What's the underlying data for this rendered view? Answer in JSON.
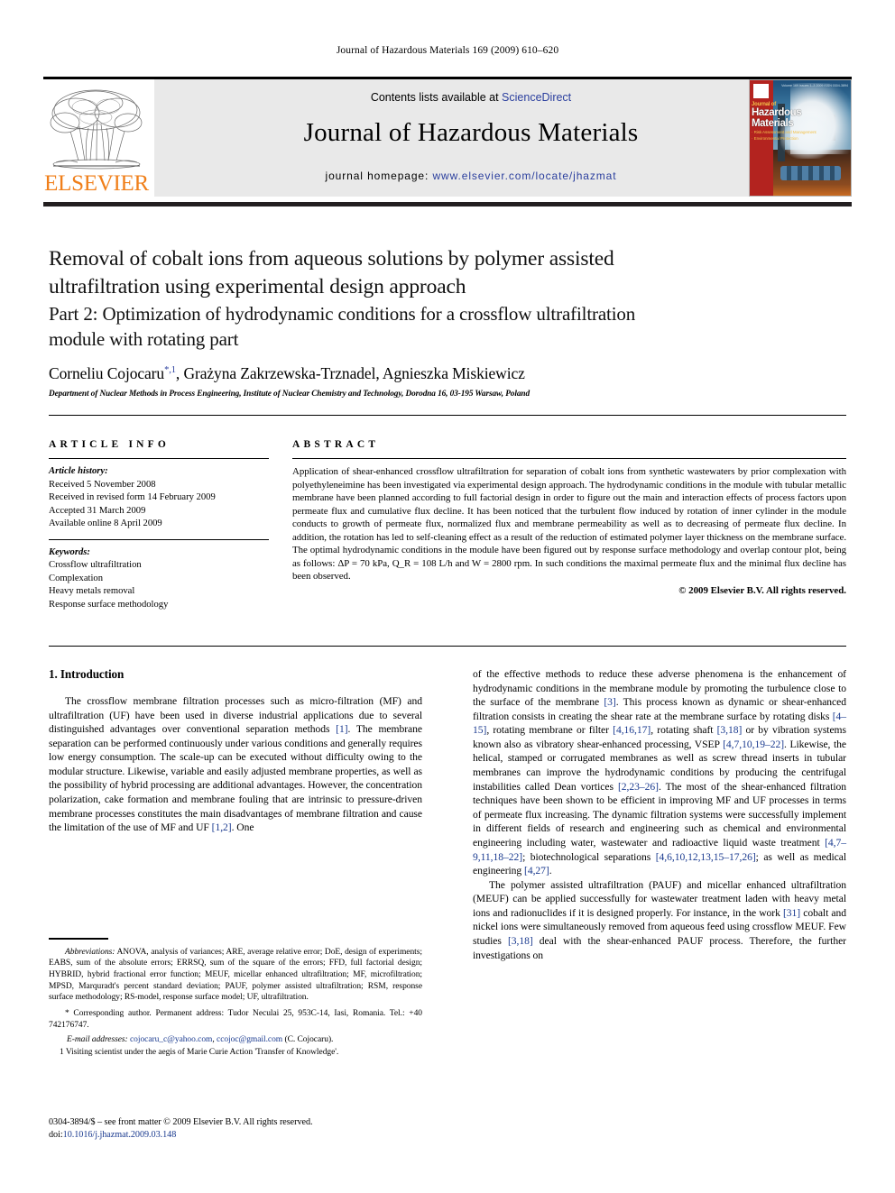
{
  "running_head": "Journal of Hazardous Materials 169 (2009) 610–620",
  "masthead": {
    "publisher_name": "ELSEVIER",
    "contents_prefix": "Contents lists available at ",
    "contents_link": "ScienceDirect",
    "journal_title": "Journal of Hazardous Materials",
    "homepage_label": "journal homepage: ",
    "homepage_url": "www.elsevier.com/locate/jhazmat",
    "cover": {
      "kicker": "Journal of",
      "line1": "Hazardous",
      "line2": "Materials",
      "sub1": "· Risk Assessment and Management",
      "sub2": "· Environmental Protection",
      "corner_note": "Volume 169 Issues 1–3  2009\nISSN 0304-3894"
    },
    "link_color": "#2b3f9e"
  },
  "title_block": {
    "title_line1": "Removal of cobalt ions from aqueous solutions by polymer assisted",
    "title_line2": "ultrafiltration using experimental design approach",
    "subtitle_line1": "Part 2: Optimization of hydrodynamic conditions for a crossflow ultrafiltration",
    "subtitle_line2": "module with rotating part",
    "author1": "Corneliu Cojocaru",
    "author1_marks": "*,1",
    "authors_rest": ", Grażyna Zakrzewska-Trznadel, Agnieszka Miskiewicz",
    "affiliation": "Department of Nuclear Methods in Process Engineering, Institute of Nuclear Chemistry and Technology, Dorodna 16, 03-195 Warsaw, Poland"
  },
  "article_info": {
    "heading": "ARTICLE INFO",
    "history_label": "Article history:",
    "history": [
      "Received 5 November 2008",
      "Received in revised form 14 February 2009",
      "Accepted 31 March 2009",
      "Available online 8 April 2009"
    ],
    "keywords_label": "Keywords:",
    "keywords": [
      "Crossflow ultrafiltration",
      "Complexation",
      "Heavy metals removal",
      "Response surface methodology"
    ]
  },
  "abstract": {
    "heading": "ABSTRACT",
    "text": "Application of shear-enhanced crossflow ultrafiltration for separation of cobalt ions from synthetic wastewaters by prior complexation with polyethyleneimine has been investigated via experimental design approach. The hydrodynamic conditions in the module with tubular metallic membrane have been planned according to full factorial design in order to figure out the main and interaction effects of process factors upon permeate flux and cumulative flux decline. It has been noticed that the turbulent flow induced by rotation of inner cylinder in the module conducts to growth of permeate flux, normalized flux and membrane permeability as well as to decreasing of permeate flux decline. In addition, the rotation has led to self-cleaning effect as a result of the reduction of estimated polymer layer thickness on the membrane surface. The optimal hydrodynamic conditions in the module have been figured out by response surface methodology and overlap contour plot, being as follows: ΔP = 70 kPa, Q_R = 108 L/h and W = 2800 rpm. In such conditions the maximal permeate flux and the minimal flux decline has been observed.",
    "copyright": "© 2009 Elsevier B.V. All rights reserved."
  },
  "body": {
    "section_number_title": "1. Introduction",
    "left_paragraph_1_a": "The crossflow membrane filtration processes such as micro-filtration (MF) and ultrafiltration (UF) have been used in diverse industrial applications due to several distinguished advantages over conventional separation methods ",
    "left_ref_1": "[1]",
    "left_paragraph_1_b": ". The membrane separation can be performed continuously under various conditions and generally requires low energy consumption. The scale-up can be executed without difficulty owing to the modular structure. Likewise, variable and easily adjusted membrane properties, as well as the possibility of hybrid processing are additional advantages. However, the concentration polarization, cake formation and membrane fouling that are intrinsic to pressure-driven membrane processes constitutes the main disadvantages of membrane filtration and cause the limitation of the use of MF and UF ",
    "left_ref_2": "[1,2]",
    "left_paragraph_1_c": ". One",
    "right_p1_a": "of the effective methods to reduce these adverse phenomena is the enhancement of hydrodynamic conditions in the membrane module by promoting the turbulence close to the surface of the membrane ",
    "right_ref_3": "[3]",
    "right_p1_b": ". This process known as dynamic or shear-enhanced filtration consists in creating the shear rate at the membrane surface by rotating disks ",
    "right_ref_4_15": "[4–15]",
    "right_p1_c": ", rotating membrane or filter ",
    "right_ref_4_16_17": "[4,16,17]",
    "right_p1_d": ", rotating shaft ",
    "right_ref_3_18": "[3,18]",
    "right_p1_e": " or by vibration systems known also as vibratory shear-enhanced processing, VSEP ",
    "right_ref_4_7_10_19_22": "[4,7,10,19–22]",
    "right_p1_f": ". Likewise, the helical, stamped or corrugated membranes as well as screw thread inserts in tubular membranes can improve the hydrodynamic conditions by producing the centrifugal instabilities called Dean vortices ",
    "right_ref_2_23_26": "[2,23–26]",
    "right_p1_g": ". The most of the shear-enhanced filtration techniques have been shown to be efficient in improving MF and UF processes in terms of permeate flux increasing. The dynamic filtration systems were successfully implement in different fields of research and engineering such as chemical and environmental engineering including water, wastewater and radioactive liquid waste treatment ",
    "right_ref_4_7_9_11_18_22": "[4,7–9,11,18–22]",
    "right_p1_h": "; biotechnological separations ",
    "right_ref_4_6_10_12_13_15_17_26": "[4,6,10,12,13,15–17,26]",
    "right_p1_i": "; as well as medical engineering ",
    "right_ref_4_27": "[4,27]",
    "right_p1_j": ".",
    "right_p2_a": "The polymer assisted ultrafiltration (PAUF) and micellar enhanced ultrafiltration (MEUF) can be applied successfully for wastewater treatment laden with heavy metal ions and radionuclides if it is designed properly. For instance, in the work ",
    "right_ref_31": "[31]",
    "right_p2_b": " cobalt and nickel ions were simultaneously removed from aqueous feed using crossflow MEUF. Few studies ",
    "right_ref_3_18_b": "[3,18]",
    "right_p2_c": " deal with the shear-enhanced PAUF process. Therefore, the further investigations on"
  },
  "footnotes": {
    "abbrev_label": "Abbreviations:",
    "abbrev_text": " ANOVA, analysis of variances; ARE, average relative error; DoE, design of experiments; EABS, sum of the absolute errors; ERRSQ, sum of the square of the errors; FFD, full factorial design; HYBRID, hybrid fractional error function; MEUF, micellar enhanced ultrafiltration; MF, microfiltration; MPSD, Marquradt's percent standard deviation; PAUF, polymer assisted ultrafiltration; RSM, response surface methodology; RS-model, response surface model; UF, ultrafiltration.",
    "corresponding": "* Corresponding author. Permanent address: Tudor Neculai 25, 953C-14, Iasi, Romania. Tel.: +40 742176747.",
    "email_label": "E-mail addresses:",
    "email_1": "cojocaru_c@yahoo.com",
    "email_2": "ccojoc@gmail.com",
    "email_tail": " (C. Cojocaru).",
    "visiting": "1 Visiting scientist under the aegis of Marie Curie Action 'Transfer of Knowledge'.",
    "issn_line": "0304-3894/$ – see front matter © 2009 Elsevier B.V. All rights reserved.",
    "doi_label": "doi:",
    "doi_value": "10.1016/j.jhazmat.2009.03.148"
  }
}
